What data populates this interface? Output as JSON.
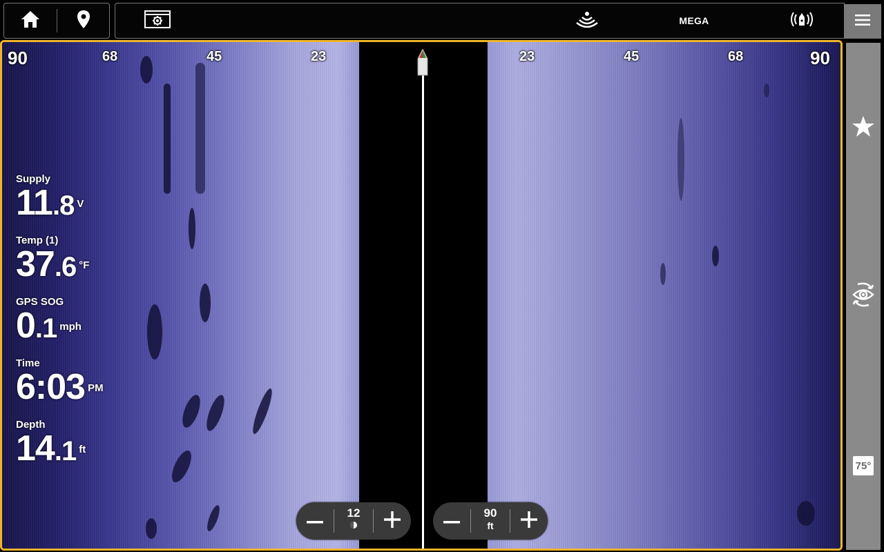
{
  "topbar": {
    "home_icon": "home-icon",
    "waypoint_icon": "map-pin-icon",
    "settings_icon": "sonar-settings-icon",
    "sonar_icon": "sonar-waves-icon",
    "frequency_label": "MEGA",
    "transmit_icon": "transducer-transmit-icon",
    "menu_icon": "hamburger-menu-icon"
  },
  "sidepanel": {
    "favorite_icon": "star-icon",
    "target_icon": "rotate-eye-icon",
    "beam_angle": "75°"
  },
  "range_labels": {
    "left": [
      "90",
      "68",
      "45",
      "23"
    ],
    "right": [
      "23",
      "45",
      "68",
      "90"
    ]
  },
  "data_overlay": {
    "supply": {
      "label": "Supply",
      "whole": "11",
      "frac": ".8",
      "unit": "V"
    },
    "temp": {
      "label": "Temp (1)",
      "whole": "37",
      "frac": ".6",
      "unit": "°F"
    },
    "sog": {
      "label": "GPS SOG",
      "whole": "0",
      "frac": ".1",
      "unit": "mph"
    },
    "time": {
      "label": "Time",
      "whole": "6:03",
      "frac": "",
      "unit": "PM"
    },
    "depth": {
      "label": "Depth",
      "whole": "14",
      "frac": ".1",
      "unit": "ft"
    }
  },
  "controls": {
    "left": {
      "value": "12",
      "unit_icon": "contrast-icon",
      "minus": "−",
      "plus": "+"
    },
    "right": {
      "value": "90",
      "unit": "ft",
      "minus": "−",
      "plus": "+"
    }
  },
  "colors": {
    "accent_border": "#f0b429",
    "side_panel": "#8a8a8a"
  }
}
